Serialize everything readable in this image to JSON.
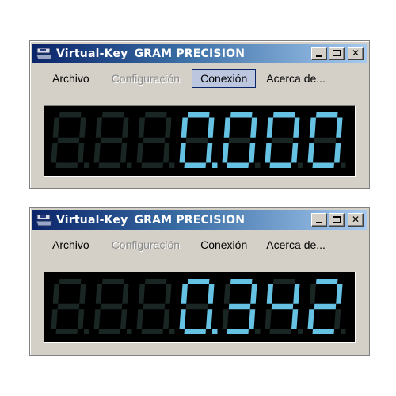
{
  "windows": [
    {
      "title_brand": "Virtual-Key",
      "title_name": "GRAM PRECISION",
      "menu": [
        {
          "label": "Archivo",
          "state": "normal"
        },
        {
          "label": "Configuración",
          "state": "disabled"
        },
        {
          "label": "Conexión",
          "state": "active"
        },
        {
          "label": "Acerca de...",
          "state": "normal"
        }
      ],
      "reading": "0.000"
    },
    {
      "title_brand": "Virtual-Key",
      "title_name": "GRAM PRECISION",
      "menu": [
        {
          "label": "Archivo",
          "state": "normal"
        },
        {
          "label": "Configuración",
          "state": "disabled"
        },
        {
          "label": "Conexión",
          "state": "normal"
        },
        {
          "label": "Acerca de...",
          "state": "normal"
        }
      ],
      "reading": "0.342"
    }
  ],
  "colors": {
    "segment_on": "#66c2e2",
    "segment_off": "#1a2624",
    "display_bg": "#000000"
  },
  "icons": [
    "app-scale-icon",
    "minimize-icon",
    "maximize-icon",
    "close-icon"
  ]
}
